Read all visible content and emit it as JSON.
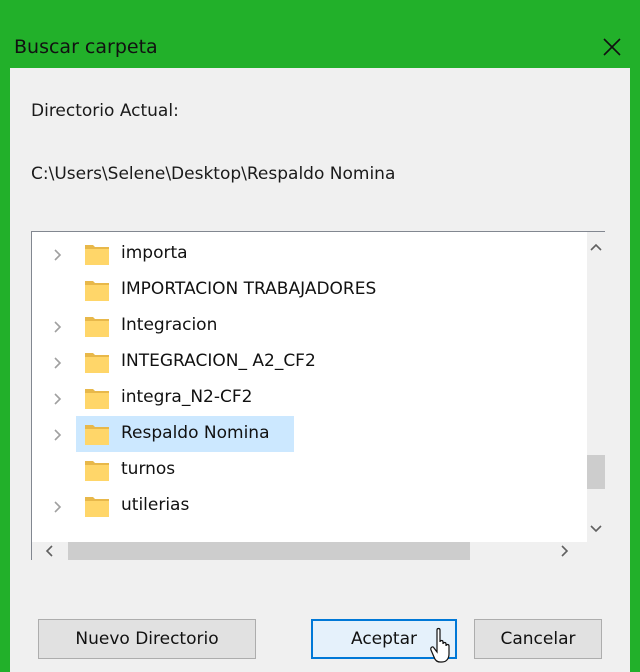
{
  "window": {
    "title": "Buscar carpeta",
    "accent_color": "#22b02a",
    "close_icon": "close-icon"
  },
  "labels": {
    "current_dir_label": "Directorio Actual:",
    "current_path": "C:\\Users\\Selene\\Desktop\\Respaldo Nomina"
  },
  "tree": {
    "items": [
      {
        "label": "importa",
        "expandable": true,
        "selected": false
      },
      {
        "label": "IMPORTACION TRABAJADORES",
        "expandable": false,
        "selected": false
      },
      {
        "label": "Integracion",
        "expandable": true,
        "selected": false
      },
      {
        "label": "INTEGRACION_ A2_CF2",
        "expandable": true,
        "selected": false
      },
      {
        "label": "integra_N2-CF2",
        "expandable": true,
        "selected": false
      },
      {
        "label": "Respaldo Nomina",
        "expandable": true,
        "selected": true
      },
      {
        "label": "turnos",
        "expandable": false,
        "selected": false
      },
      {
        "label": "utilerias",
        "expandable": true,
        "selected": false
      }
    ],
    "selection_color": "#cce8ff",
    "folder_color": "#ffd669"
  },
  "buttons": {
    "new_dir": "Nuevo Directorio",
    "accept": "Aceptar",
    "cancel": "Cancelar"
  }
}
